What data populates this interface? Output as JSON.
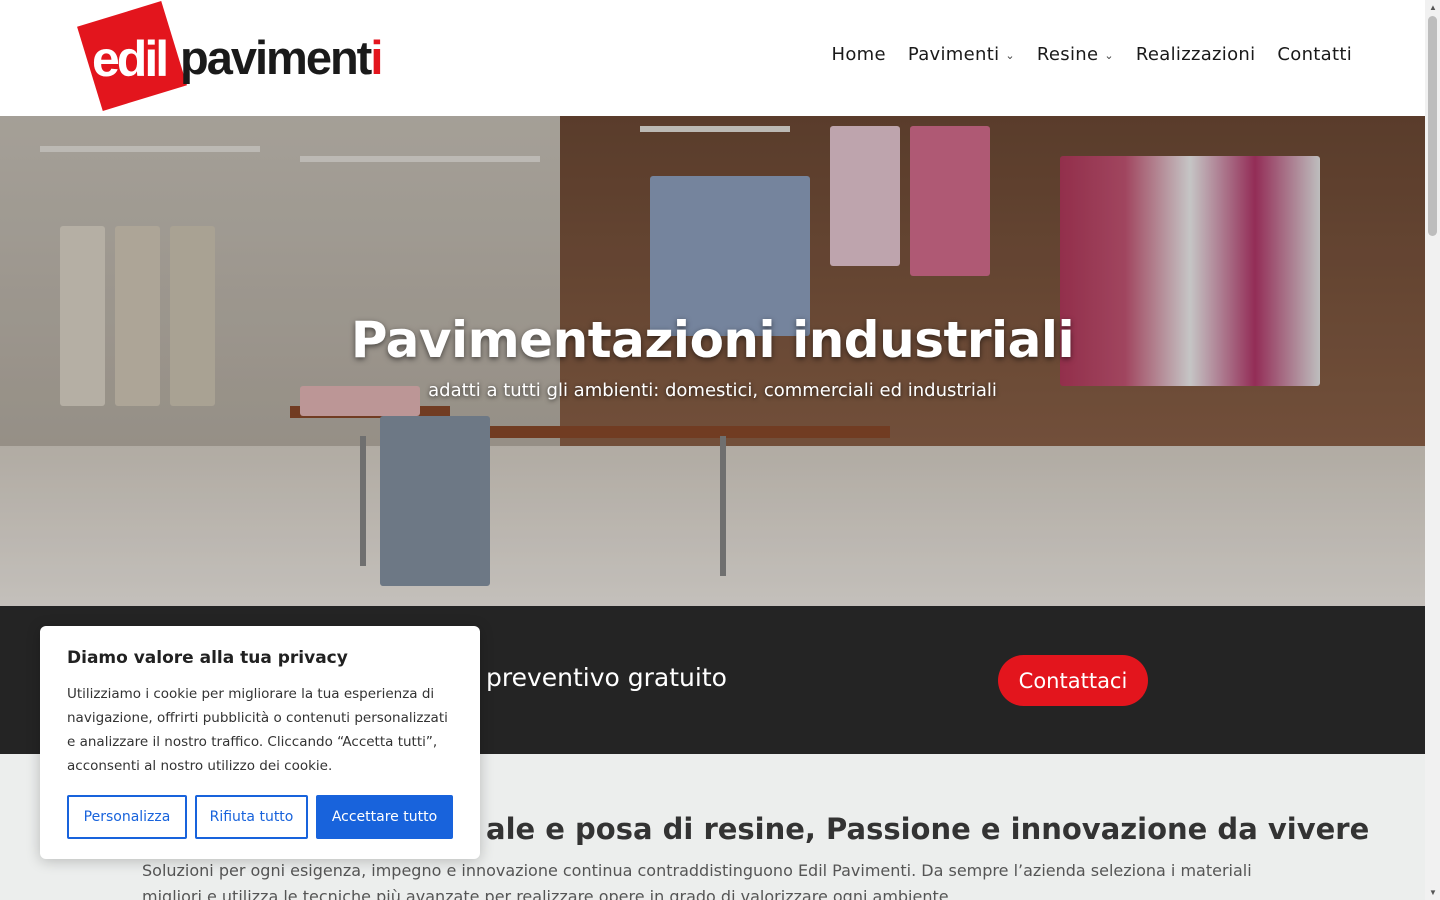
{
  "brand": {
    "part1": "edil",
    "part2": "paviment",
    "part3": "i"
  },
  "nav": [
    {
      "label": "Home",
      "has_dropdown": false
    },
    {
      "label": "Pavimenti",
      "has_dropdown": true
    },
    {
      "label": "Resine",
      "has_dropdown": true
    },
    {
      "label": "Realizzazioni",
      "has_dropdown": false
    },
    {
      "label": "Contatti",
      "has_dropdown": false
    }
  ],
  "hero": {
    "title": "Pavimentazioni industriali",
    "subtitle": "adatti a tutti gli ambienti: domestici, commerciali ed industriali"
  },
  "cta": {
    "text": "preventivo gratuito",
    "button": "Contattaci"
  },
  "content": {
    "title": "ale e posa di resine, Passione e innovazione da vivere",
    "paragraph": "Soluzioni per ogni esigenza, impegno e innovazione continua contraddistinguono Edil Pavimenti. Da sempre l’azienda seleziona i materiali migliori e utilizza le tecniche più avanzate per realizzare opere in grado di valorizzare ogni ambiente."
  },
  "cookie": {
    "title": "Diamo valore alla tua privacy",
    "text": "Utilizziamo i cookie per migliorare la tua esperienza di navigazione, offrirti pubblicità o contenuti personalizzati e analizzare il nostro traffico. Cliccando “Accetta tutti”, acconsenti al nostro utilizzo dei cookie.",
    "buttons": {
      "customize": "Personalizza",
      "reject": "Rifiuta tutto",
      "accept": "Accettare tutto"
    }
  },
  "colors": {
    "brand_red": "#e3151d",
    "cookie_blue": "#1863dc",
    "cta_band": "#242424"
  }
}
